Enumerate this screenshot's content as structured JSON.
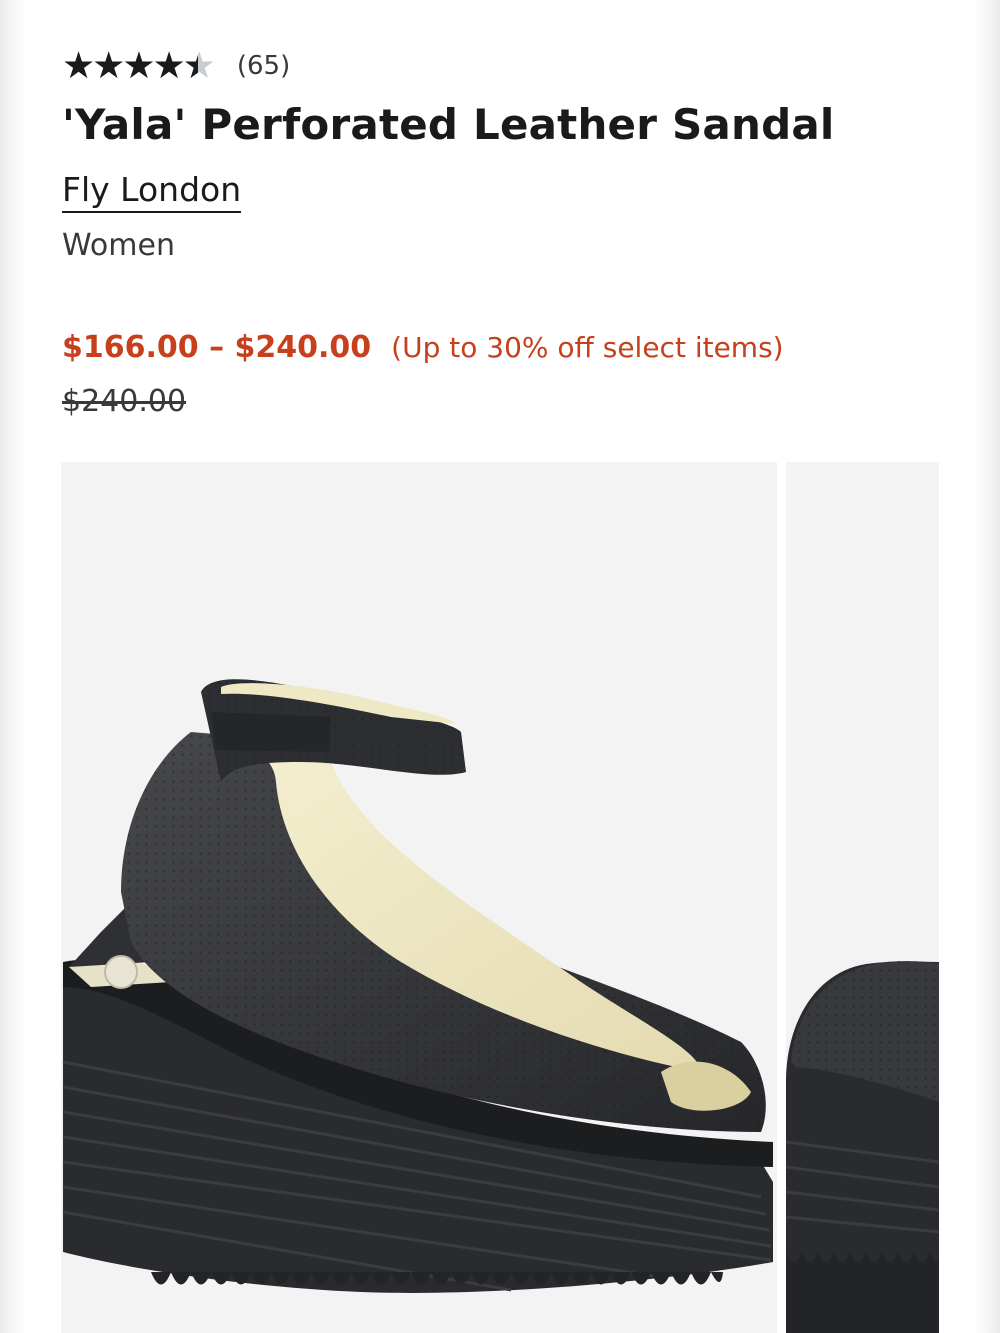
{
  "product": {
    "rating": {
      "value": 4.5,
      "max": 5,
      "star_glyphs": "★★★★★",
      "review_count": "(65)"
    },
    "title": "'Yala' Perforated Leather Sandal",
    "brand": "Fly London",
    "category": "Women"
  },
  "pricing": {
    "sale_range": "$166.00 – $240.00",
    "discount_note": "(Up to 30% off select items)",
    "original": "$240.00"
  },
  "gallery": {
    "images": [
      "sandal-side-view-image",
      "sandal-angle-view-image"
    ]
  },
  "colors": {
    "sale_red": "#c7401b",
    "text_dark": "#191a1b",
    "star_empty": "#c9cdd2",
    "image_bg": "#f3f3f3",
    "leather": "#2f3033",
    "lining": "#efe8c4"
  }
}
